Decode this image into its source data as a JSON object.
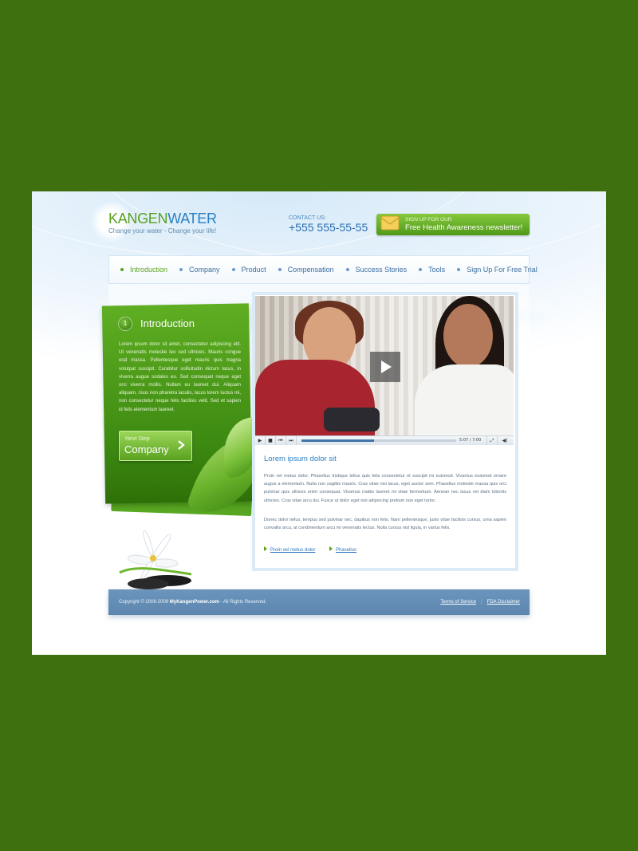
{
  "header": {
    "logo_part1": "KANGEN",
    "logo_part2": "WATER",
    "tagline": "Change your water - Change your life!",
    "contact_label": "CONTACT US:",
    "phone": "+555 555-55-55",
    "newsletter_small": "SIGN UP FOR OUR",
    "newsletter_big": "Free Health Awareness newsletter!"
  },
  "nav": {
    "items": [
      {
        "label": "Introduction",
        "active": true
      },
      {
        "label": "Company"
      },
      {
        "label": "Product"
      },
      {
        "label": "Compensation"
      },
      {
        "label": "Success Stories"
      },
      {
        "label": "Tools"
      },
      {
        "label": "Sign Up For Free Trial"
      }
    ]
  },
  "intro": {
    "number": "1",
    "title": "Introduction",
    "text": "Lorem ipsum dolor sit amet, consectetur adipiscing elit. Ut venenatis molestie leo sed ultricies. Mauris congue erat massa. Pellentesque eget mauris quis magna volutpat suscipit. Curabitur sollicitudin dictum lacus, in viverra augue sodales eu. Sed consequat neque eget orci viverra mollis. Nullam eu laoreet dui. Aliquam aliquam, risus non pharetra iaculis, lacus lorem luctus mi, non consectetur neque felis facilisis velit. Sed et sapien id felis elementum laoreet.",
    "next_small": "Next Step",
    "next_big": "Company"
  },
  "video": {
    "time": "5:07 / 7:00",
    "progress": 0.47
  },
  "article": {
    "title": "Lorem ipsum dolor sit",
    "p1": "Proin vel metus dolor. Phasellus tristique tellus quis felis consectetur et suscipit mi euismod. Vivamus euismod ornare augue a elementum. Nulla non sagittis mauris. Cras vitae nisi lacus, eget auctor sem. Phasellus molestie massa quis orci pulvinar quis ultrices enim consequat. Vivamus mattis laoreet mi vitae fermentum. Aenean nec lacus vel diam lobortis ultricies. Cras vitae arcu dui. Fusce ut dolor eget nisi adipiscing pretium non eget tortor.",
    "p2": "Donec dolor tellus, tempus sed pulvinar nec, dapibus non felis. Nam pellentesque, justo vitae facilisis cursus, urna sapien convallis arcu, at condimentum arcu mi venenatis lectus. Nulla cursus nisl ligula, in varius felis.",
    "link1": "Proin vel metus dolor",
    "link2": "Phasellus"
  },
  "footer": {
    "copyright_prefix": "Copyright © 2006-2009 ",
    "site": "MyKangenPower.com",
    "copyright_suffix": " - All Rights Reserved.",
    "terms": "Terms of Service",
    "sep": "|",
    "fda": "FDA Disclaimer"
  },
  "colors": {
    "page_bg": "#3f7010",
    "brand_green": "#5aa21a",
    "brand_blue": "#2a80c4",
    "footer_blue": "#6690b8"
  }
}
